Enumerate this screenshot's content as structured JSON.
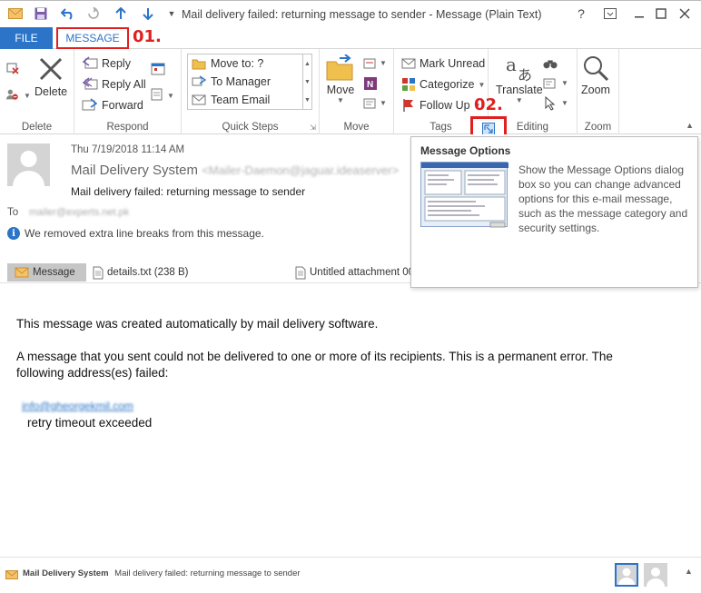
{
  "window": {
    "title": "Mail delivery failed: returning message to sender - Message  (Plain Text)",
    "help_label": "?"
  },
  "tabs": {
    "file": "FILE",
    "message": "MESSAGE"
  },
  "callouts": {
    "first": "01.",
    "second": "02."
  },
  "ribbon": {
    "delete": {
      "delete_label": "Delete",
      "group_label": "Delete"
    },
    "respond": {
      "reply": "Reply",
      "reply_all": "Reply All",
      "forward": "Forward",
      "group_label": "Respond"
    },
    "quick_steps": {
      "items": [
        "Move to: ?",
        "To Manager",
        "Team Email"
      ],
      "group_label": "Quick Steps"
    },
    "move": {
      "move_label": "Move",
      "group_label": "Move"
    },
    "tags": {
      "mark_unread": "Mark Unread",
      "categorize": "Categorize",
      "follow_up": "Follow Up",
      "group_label": "Tags"
    },
    "editing": {
      "translate": "Translate",
      "group_label": "Editing"
    },
    "zoom": {
      "zoom_label": "Zoom",
      "group_label": "Zoom"
    }
  },
  "message": {
    "date": "Thu 7/19/2018 11:14 AM",
    "from_name": "Mail Delivery System",
    "from_address": "<Mailer-Daemon@jaguar.ideaserver>",
    "subject": "Mail delivery failed: returning message to sender",
    "to_label": "To",
    "to_value": "mailer@experts.net.pk",
    "info": "We removed extra line breaks from this message.",
    "attachments": [
      {
        "label": "Message"
      },
      {
        "label": "details.txt (238 B)"
      },
      {
        "label": "Untitled attachment 00"
      }
    ],
    "body": {
      "line1": "This message was created automatically by mail delivery software.",
      "line2": "A message that you sent could not be delivered to one or more of its recipients. This is a permanent error. The",
      "line3": "following address(es) failed:",
      "address": "info@gheorgekmil.com",
      "error": "retry timeout exceeded"
    }
  },
  "popup": {
    "title": "Message Options",
    "description": "Show the Message Options dialog box so you can change advanced options for this e-mail message, such as the message category and security settings."
  },
  "statusbar": {
    "sender": "Mail Delivery System",
    "subject": "Mail delivery failed: returning message to sender"
  },
  "colors": {
    "accent": "#2b74c7",
    "highlight": "#e0201f"
  }
}
